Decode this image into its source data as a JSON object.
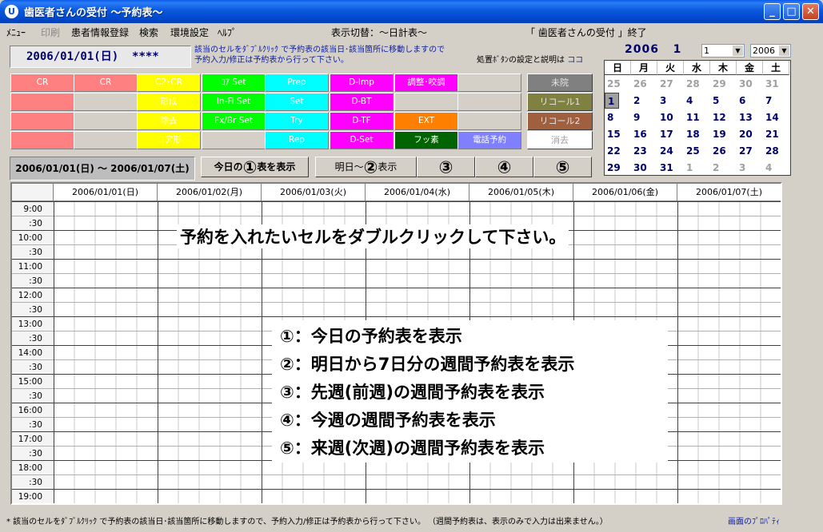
{
  "window": {
    "title": "歯医者さんの受付 ～予約表～",
    "app_icon": "U"
  },
  "menu": {
    "items": [
      "ﾒﾆｭｰ",
      "印刷",
      "患者情報登録",
      "検索",
      "環境設定",
      "ﾍﾙﾌﾟ"
    ],
    "view_switch": "表示切替：～日計表～",
    "exit_label": "「 歯医者さんの受付 」終了"
  },
  "header": {
    "current_date": "2006/01/01(日)",
    "stars": "****",
    "note_line1": "該当のセルをﾀﾞﾌﾞﾙｸﾘｯｸ で予約表の該当日･該当箇所に移動しますので",
    "note_line2": "予約入力/修正は予約表から行って下さい。",
    "proc_note": "処置ﾎﾞﾀﾝの設定と説明は",
    "proc_link": "ココ"
  },
  "category_buttons": [
    {
      "row": 0,
      "col": 0,
      "label": "CR",
      "color": "#ff8080"
    },
    {
      "row": 0,
      "col": 1,
      "label": "CR",
      "color": "#ff8080"
    },
    {
      "row": 0,
      "col": 2,
      "label": "C2･CR",
      "color": "#ffff00"
    },
    {
      "row": 0,
      "col": 3,
      "label": "ｺｱ Set",
      "color": "#00ff00"
    },
    {
      "row": 0,
      "col": 4,
      "label": "Prep",
      "color": "#00ffff"
    },
    {
      "row": 0,
      "col": 5,
      "label": "D-Imp",
      "color": "#ff00ff"
    },
    {
      "row": 0,
      "col": 6,
      "label": "調整･咬調",
      "color": "#ff00ff"
    },
    {
      "row": 0,
      "col": 7,
      "label": "",
      "color": "#d4d0c8"
    },
    {
      "row": 1,
      "col": 0,
      "label": "",
      "color": "#ff8080"
    },
    {
      "row": 1,
      "col": 1,
      "label": "",
      "color": "#d4d0c8"
    },
    {
      "row": 1,
      "col": 2,
      "label": "形成",
      "color": "#ffff00"
    },
    {
      "row": 1,
      "col": 3,
      "label": "In-Fi Set",
      "color": "#00ff00"
    },
    {
      "row": 1,
      "col": 4,
      "label": "Set",
      "color": "#00ffff"
    },
    {
      "row": 1,
      "col": 5,
      "label": "D-BT",
      "color": "#ff00ff"
    },
    {
      "row": 1,
      "col": 6,
      "label": "",
      "color": "#d4d0c8"
    },
    {
      "row": 1,
      "col": 7,
      "label": "",
      "color": "#d4d0c8"
    },
    {
      "row": 2,
      "col": 0,
      "label": "",
      "color": "#ff8080"
    },
    {
      "row": 2,
      "col": 1,
      "label": "",
      "color": "#d4d0c8"
    },
    {
      "row": 2,
      "col": 2,
      "label": "除去",
      "color": "#ffff00"
    },
    {
      "row": 2,
      "col": 3,
      "label": "Fx/Br Set",
      "color": "#00ff00"
    },
    {
      "row": 2,
      "col": 4,
      "label": "Try",
      "color": "#00ffff"
    },
    {
      "row": 2,
      "col": 5,
      "label": "D-TF",
      "color": "#ff00ff"
    },
    {
      "row": 2,
      "col": 6,
      "label": "EXT",
      "color": "#ff8000"
    },
    {
      "row": 2,
      "col": 7,
      "label": "",
      "color": "#d4d0c8"
    },
    {
      "row": 3,
      "col": 0,
      "label": "",
      "color": "#ff8080"
    },
    {
      "row": 3,
      "col": 1,
      "label": "",
      "color": "#d4d0c8"
    },
    {
      "row": 3,
      "col": 2,
      "label": "コア形",
      "color": "#ffff00"
    },
    {
      "row": 3,
      "col": 3,
      "label": "",
      "color": "#d4d0c8"
    },
    {
      "row": 3,
      "col": 4,
      "label": "Rep",
      "color": "#00ffff"
    },
    {
      "row": 3,
      "col": 5,
      "label": "D-Set",
      "color": "#ff00ff"
    },
    {
      "row": 3,
      "col": 6,
      "label": "フッ素",
      "color": "#006400"
    },
    {
      "row": 3,
      "col": 7,
      "label": "電話予約",
      "color": "#8080ff"
    }
  ],
  "side_buttons": [
    {
      "label": "未院",
      "color": "#808080"
    },
    {
      "label": "リコール1",
      "color": "#808040"
    },
    {
      "label": "リコール2",
      "color": "#a06040"
    },
    {
      "label": "消去",
      "color": "#ffffff"
    }
  ],
  "range": "2006/01/01(日) ～ 2006/01/07(土)",
  "nav": [
    {
      "num": "①",
      "pre": "今日の",
      "post": "表を表示"
    },
    {
      "num": "②",
      "pre": "明日～",
      "post": "表示"
    },
    {
      "num": "③",
      "pre": "",
      "post": ""
    },
    {
      "num": "④",
      "pre": "",
      "post": ""
    },
    {
      "num": "⑤",
      "pre": "",
      "post": ""
    }
  ],
  "calendar": {
    "year": "2006",
    "month": "1",
    "month_select": "1",
    "year_select": "2006",
    "weekdays": [
      "日",
      "月",
      "火",
      "水",
      "木",
      "金",
      "土"
    ],
    "weeks": [
      [
        {
          "d": "25",
          "o": true
        },
        {
          "d": "26",
          "o": true
        },
        {
          "d": "27",
          "o": true
        },
        {
          "d": "28",
          "o": true
        },
        {
          "d": "29",
          "o": true
        },
        {
          "d": "30",
          "o": true
        },
        {
          "d": "31",
          "o": true
        }
      ],
      [
        {
          "d": "1",
          "s": true
        },
        {
          "d": "2"
        },
        {
          "d": "3"
        },
        {
          "d": "4"
        },
        {
          "d": "5"
        },
        {
          "d": "6"
        },
        {
          "d": "7"
        }
      ],
      [
        {
          "d": "8"
        },
        {
          "d": "9"
        },
        {
          "d": "10"
        },
        {
          "d": "11"
        },
        {
          "d": "12"
        },
        {
          "d": "13"
        },
        {
          "d": "14"
        }
      ],
      [
        {
          "d": "15"
        },
        {
          "d": "16"
        },
        {
          "d": "17"
        },
        {
          "d": "18"
        },
        {
          "d": "19"
        },
        {
          "d": "20"
        },
        {
          "d": "21"
        }
      ],
      [
        {
          "d": "22"
        },
        {
          "d": "23"
        },
        {
          "d": "24"
        },
        {
          "d": "25"
        },
        {
          "d": "26"
        },
        {
          "d": "27"
        },
        {
          "d": "28"
        }
      ],
      [
        {
          "d": "29"
        },
        {
          "d": "30"
        },
        {
          "d": "31"
        },
        {
          "d": "1",
          "o": true
        },
        {
          "d": "2",
          "o": true
        },
        {
          "d": "3",
          "o": true
        },
        {
          "d": "4",
          "o": true
        }
      ]
    ]
  },
  "schedule": {
    "days": [
      "2006/01/01(日)",
      "2006/01/02(月)",
      "2006/01/03(火)",
      "2006/01/04(水)",
      "2006/01/05(木)",
      "2006/01/06(金)",
      "2006/01/07(土)"
    ],
    "times": [
      "9:00",
      ":30",
      "10:00",
      ":30",
      "11:00",
      ":30",
      "12:00",
      ":30",
      "13:00",
      ":30",
      "14:00",
      ":30",
      "15:00",
      ":30",
      "16:00",
      ":30",
      "17:00",
      ":30",
      "18:00",
      ":30",
      "19:00"
    ],
    "instruction": "予約を入れたいセルをダブルクリックして下さい。"
  },
  "legend": [
    "①：今日の予約表を表示",
    "②：明日から7日分の週間予約表を表示",
    "③：先週(前週)の週間予約表を表示",
    "④：今週の週間予約表を表示",
    "⑤：来週(次週)の週間予約表を表示"
  ],
  "status": {
    "text": "* 該当のセルをﾀﾞﾌﾞﾙｸﾘｯｸ で予約表の該当日･該当箇所に移動しますので、予約入力/修正は予約表から行って下さい。 （週間予約表は、表示のみで入力は出来ません。）",
    "link": "画面のﾌﾟﾛﾊﾟﾃｨ"
  }
}
